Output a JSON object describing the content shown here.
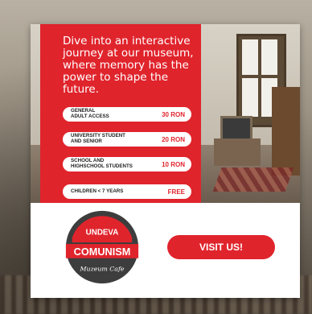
{
  "promo": {
    "headline": "Dive into an interactive journey at our museum, where memory has the power to shape the future.",
    "prices": [
      {
        "label": "GENERAL\nADULT ACCESS",
        "price": "30 RON"
      },
      {
        "label": "UNIVERSITY STUDENT\nAND SENIOR",
        "price": "20 RON"
      },
      {
        "label": "SCHOOL AND\nHIGHSCHOOL STUDENTS",
        "price": "10 RON"
      },
      {
        "label": "CHILDREN < 7 YEARS",
        "price": "FREE"
      }
    ],
    "logo": {
      "top": "UNDEVA",
      "main": "COMUNISM",
      "script": "Muzeum Cafe"
    },
    "visit_label": "VISIT US!",
    "colors": {
      "accent": "#e0242c",
      "logo_dark": "#3d3d3d"
    }
  }
}
